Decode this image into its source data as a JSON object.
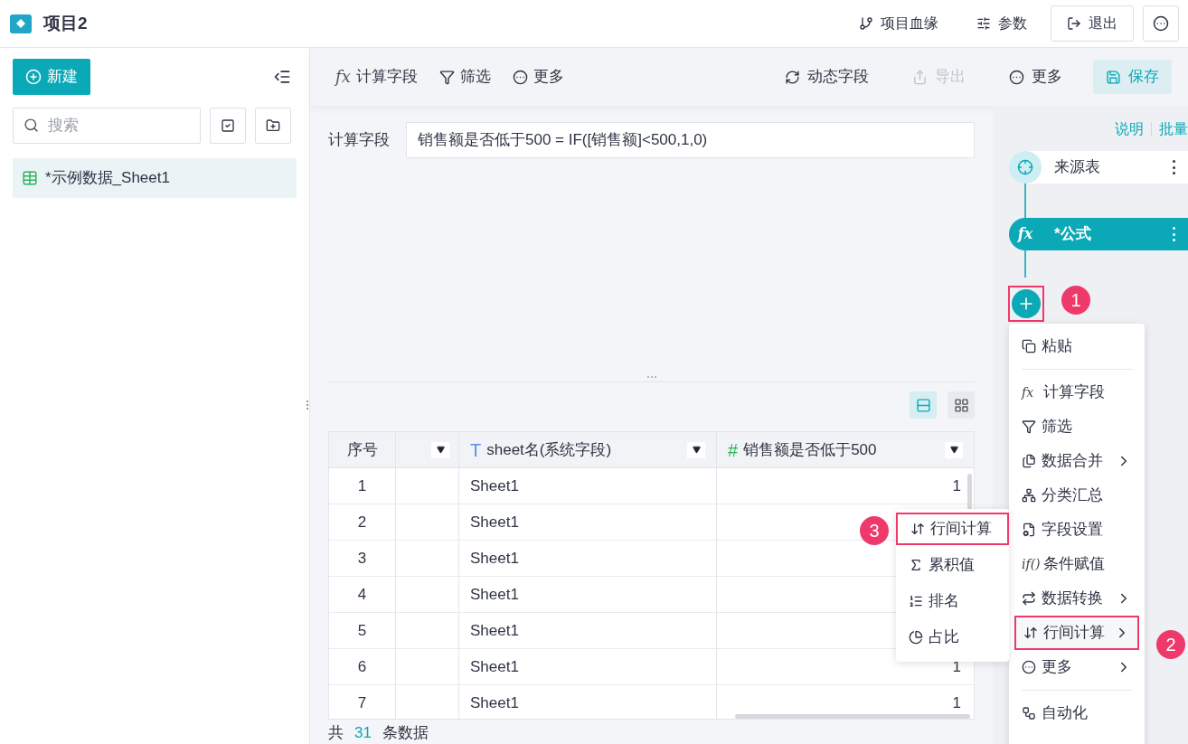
{
  "header": {
    "title": "项目2",
    "actions": [
      {
        "label": "项目血缘",
        "kind": "plain"
      },
      {
        "label": "参数",
        "kind": "plain"
      },
      {
        "label": "退出",
        "kind": "outlined"
      }
    ]
  },
  "sidebar": {
    "new_button": "新建",
    "search": {
      "placeholder": "搜索"
    },
    "items": [
      {
        "label": "*示例数据_Sheet1",
        "selected": true
      }
    ]
  },
  "toolbar": {
    "left": [
      {
        "glyph": "fx",
        "label": "计算字段"
      },
      {
        "label": "筛选"
      },
      {
        "label": "更多"
      }
    ],
    "right": [
      {
        "label": "动态字段",
        "kind": "plain",
        "disabled": false
      },
      {
        "label": "导出",
        "kind": "plain",
        "disabled": true
      },
      {
        "label": "更多",
        "kind": "plain",
        "disabled": false
      },
      {
        "label": "保存",
        "kind": "primary",
        "disabled": false
      }
    ]
  },
  "formula": {
    "label": "计算字段",
    "value": "销售额是否低于500 = IF([销售额]<500,1,0)"
  },
  "view_toggle": [
    {
      "selected": true
    },
    {
      "selected": false
    }
  ],
  "table": {
    "columns": [
      {
        "label": "序号"
      },
      {
        "glyph": "T",
        "label": "sheet名(系统字段)"
      },
      {
        "glyph": "#",
        "label": "销售额是否低于500"
      }
    ],
    "rows": [
      {
        "index": "1",
        "sheet": "Sheet1",
        "value": "1"
      },
      {
        "index": "2",
        "sheet": "Sheet1"
      },
      {
        "index": "3",
        "sheet": "Sheet1"
      },
      {
        "index": "4",
        "sheet": "Sheet1"
      },
      {
        "index": "5",
        "sheet": "Sheet1"
      },
      {
        "index": "6",
        "sheet": "Sheet1",
        "value": "1"
      },
      {
        "index": "7",
        "sheet": "Sheet1",
        "value": "1"
      }
    ]
  },
  "footer": {
    "prefix": "共",
    "count": "31",
    "suffix": "条数据"
  },
  "flow": {
    "links": [
      "说明",
      "批量"
    ],
    "nodes": [
      {
        "kind": "source",
        "label": "来源表",
        "selected": false
      },
      {
        "kind": "formula",
        "glyph": "fx",
        "label": "*公式",
        "selected": true
      }
    ]
  },
  "add_menu": {
    "items": [
      {
        "label": "粘贴",
        "submenu": false,
        "selected": false
      },
      {
        "kind": "divider"
      },
      {
        "glyph": "fx",
        "label": "计算字段",
        "submenu": false,
        "selected": false
      },
      {
        "label": "筛选",
        "submenu": false,
        "selected": false
      },
      {
        "label": "数据合并",
        "submenu": true,
        "selected": false
      },
      {
        "label": "分类汇总",
        "submenu": false,
        "selected": false
      },
      {
        "label": "字段设置",
        "submenu": false,
        "selected": false
      },
      {
        "glyph": "if()",
        "label": "条件赋值",
        "submenu": false,
        "selected": false
      },
      {
        "label": "数据转换",
        "submenu": true,
        "selected": false
      },
      {
        "label": "行间计算",
        "submenu": true,
        "selected": true
      },
      {
        "label": "更多",
        "submenu": true,
        "selected": false
      },
      {
        "kind": "divider"
      },
      {
        "label": "自动化",
        "submenu": false,
        "selected": false
      }
    ]
  },
  "sub_menu": {
    "items": [
      {
        "label": "行间计算",
        "selected": true
      },
      {
        "label": "累积值",
        "selected": false
      },
      {
        "label": "排名",
        "selected": false
      },
      {
        "label": "占比",
        "selected": false
      }
    ]
  },
  "callouts": [
    "1",
    "2",
    "3"
  ]
}
